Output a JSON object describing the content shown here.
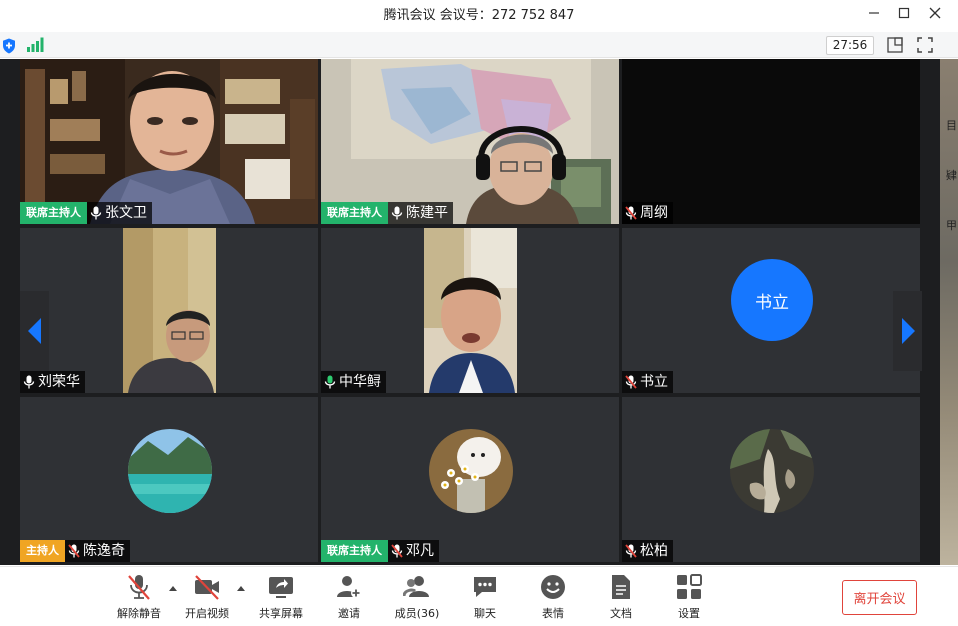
{
  "window": {
    "title": "腾讯会议 会议号：272 752 847"
  },
  "infobar": {
    "timer": "27:56"
  },
  "side_text": [
    "目",
    "肄",
    "甲"
  ],
  "tiles": [
    {
      "name": "张文卫",
      "role": "联席主持人",
      "muted": false
    },
    {
      "name": "陈建平",
      "role": "联席主持人",
      "muted": false
    },
    {
      "name": "周纲",
      "role": "",
      "muted": true
    },
    {
      "name": "刘荣华",
      "role": "",
      "muted": false
    },
    {
      "name": "中华鲟",
      "role": "",
      "muted": false
    },
    {
      "name": "书立",
      "role": "",
      "muted": true,
      "avatar_text": "书立"
    },
    {
      "name": "陈逸奇",
      "role": "主持人",
      "muted": true
    },
    {
      "name": "邓凡",
      "role": "联席主持人",
      "muted": true
    },
    {
      "name": "松柏",
      "role": "",
      "muted": true
    }
  ],
  "toolbar": {
    "unmute": "解除静音",
    "video": "开启视频",
    "share": "共享屏幕",
    "invite": "邀请",
    "members": "成员(36)",
    "chat": "聊天",
    "emoji": "表情",
    "docs": "文档",
    "settings": "设置",
    "leave": "离开会议"
  },
  "colors": {
    "cohost": "#23b36b",
    "host": "#f0a523",
    "accent": "#1677ff",
    "leave": "#e0443b"
  }
}
